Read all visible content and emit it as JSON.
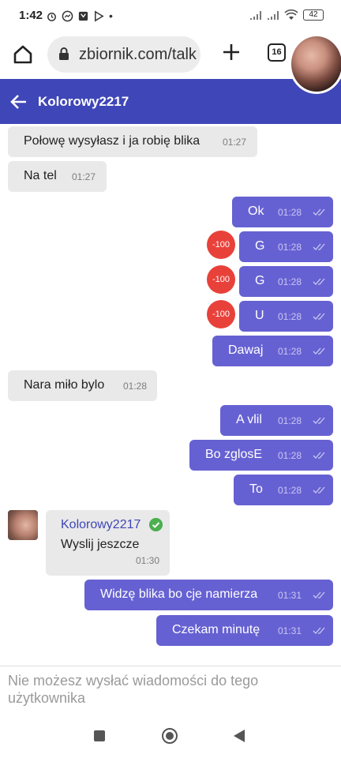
{
  "status_bar": {
    "time": "1:42",
    "battery": "42"
  },
  "browser": {
    "url": "zbiornik.com/talk",
    "tab_count": "16"
  },
  "chat": {
    "title": "Kolorowy2217",
    "messages": [
      {
        "dir": "in",
        "text": "Połowę wysyłasz i ja robię blika",
        "time": "01:27"
      },
      {
        "dir": "in",
        "text": "Na tel",
        "time": "01:27"
      },
      {
        "dir": "out",
        "text": "Ok",
        "time": "01:28"
      },
      {
        "dir": "out",
        "text": "G",
        "time": "01:28",
        "badge": "-100"
      },
      {
        "dir": "out",
        "text": "G",
        "time": "01:28",
        "badge": "-100"
      },
      {
        "dir": "out",
        "text": "U",
        "time": "01:28",
        "badge": "-100"
      },
      {
        "dir": "out",
        "text": "Dawaj",
        "time": "01:28"
      },
      {
        "dir": "in",
        "text": "Nara miło bylo",
        "time": "01:28"
      },
      {
        "dir": "out",
        "text": "A vlil",
        "time": "01:28"
      },
      {
        "dir": "out",
        "text": "Bo zglosE",
        "time": "01:28"
      },
      {
        "dir": "out",
        "text": "To",
        "time": "01:28"
      },
      {
        "dir": "in",
        "sender": "Kolorowy2217",
        "text": "Wyslij jeszcze",
        "time": "01:30"
      },
      {
        "dir": "out",
        "text": "Widzę blika bo cje namierza",
        "time": "01:31"
      },
      {
        "dir": "out",
        "text": "Czekam minutę",
        "time": "01:31"
      }
    ]
  },
  "composer": {
    "notice": "Nie możesz wysłać wiadomości do tego użytkownika"
  },
  "colors": {
    "header": "#3f46b8",
    "outgoing": "#6661d2",
    "incoming": "#e9e9e9",
    "badge": "#e8413a"
  }
}
